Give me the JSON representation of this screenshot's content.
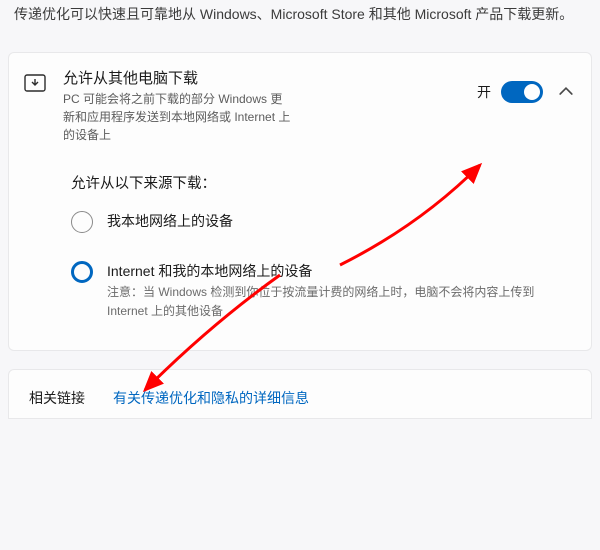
{
  "intro": "传递优化可以快速且可靠地从 Windows、Microsoft Store 和其他 Microsoft 产品下载更新。",
  "card": {
    "title": "允许从其他电脑下载",
    "desc": "PC 可能会将之前下载的部分 Windows 更新和应用程序发送到本地网络或 Internet 上的设备上",
    "toggle_label": "开"
  },
  "radio": {
    "heading": "允许从以下来源下载：",
    "option1_label": "我本地网络上的设备",
    "option2_label": "Internet 和我的本地网络上的设备",
    "option2_note": "注意：当 Windows 检测到你位于按流量计费的网络上时，电脑不会将内容上传到 Internet 上的其他设备"
  },
  "footer": {
    "title": "相关链接",
    "link": "有关传递优化和隐私的详细信息"
  }
}
